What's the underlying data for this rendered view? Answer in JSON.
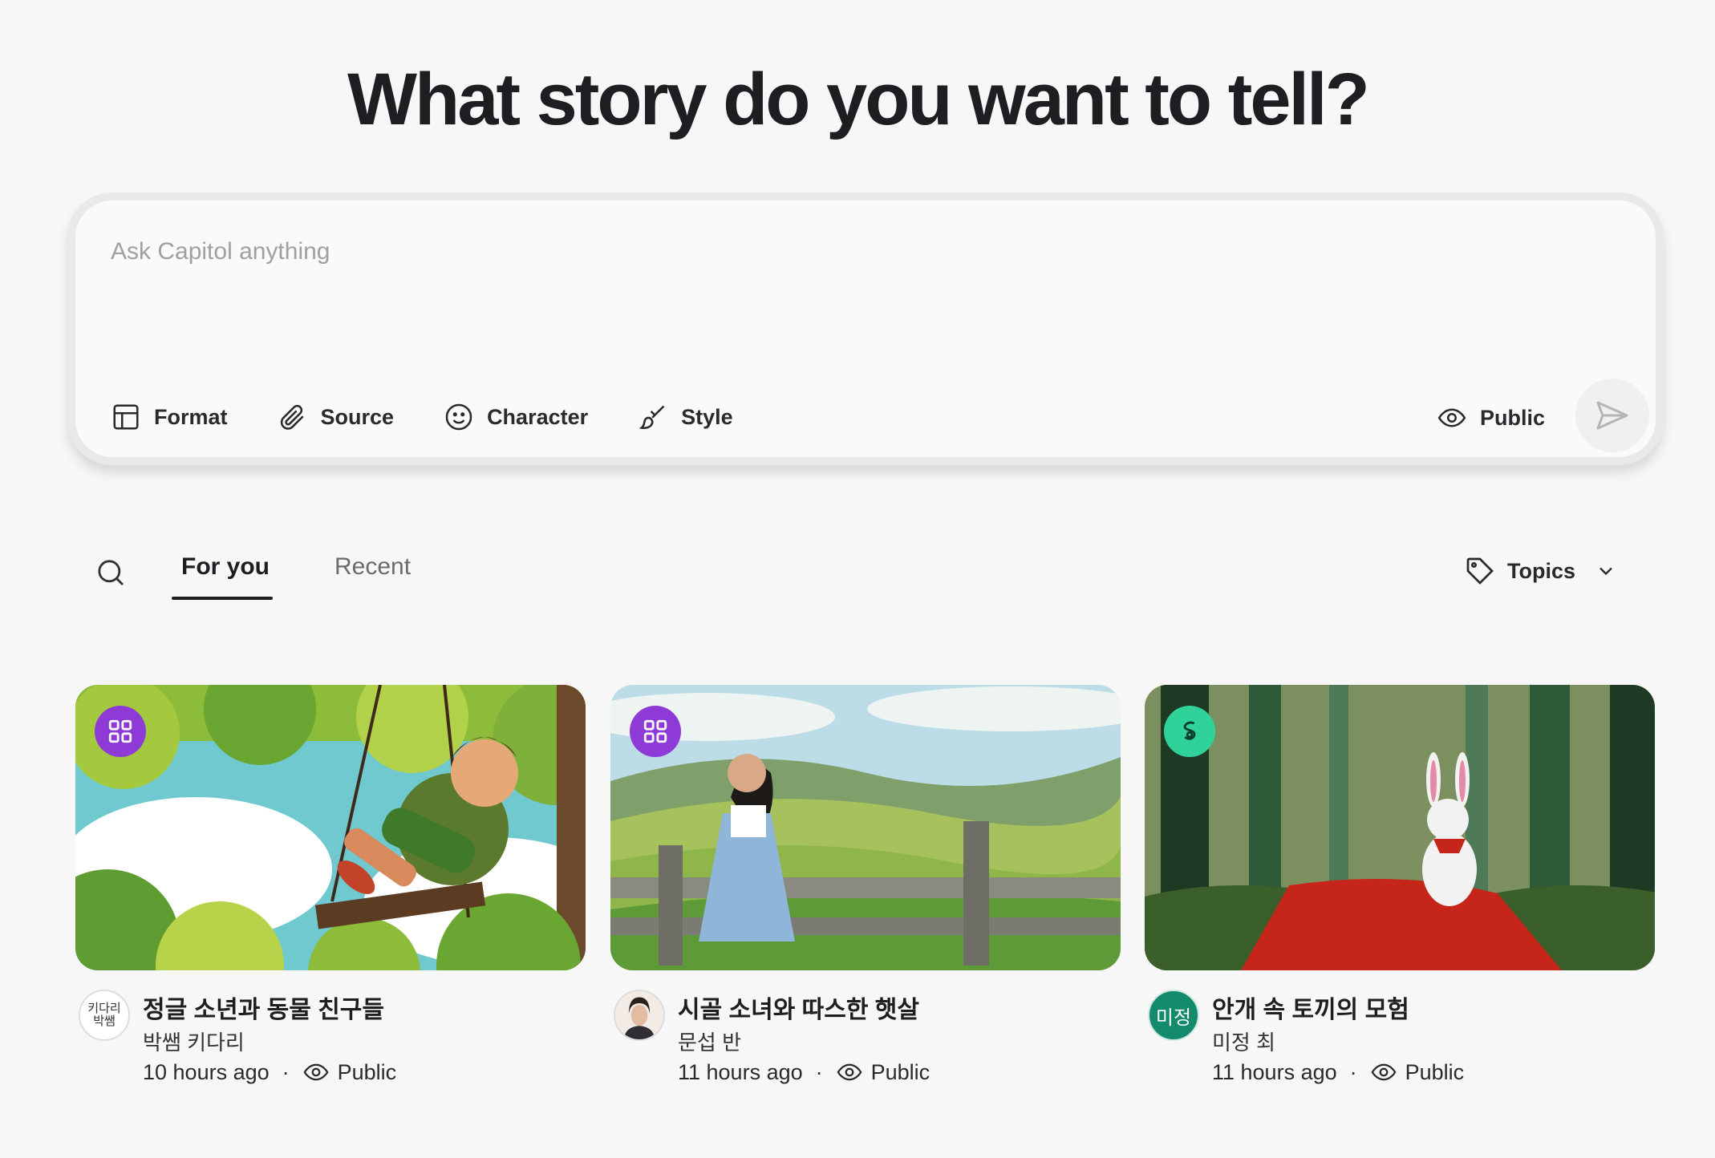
{
  "headline": "What story do you want to tell?",
  "prompt": {
    "placeholder": "Ask Capitol anything",
    "tools": [
      "Format",
      "Source",
      "Character",
      "Style"
    ],
    "visibility": "Public"
  },
  "feed": {
    "tabs": [
      "For you",
      "Recent"
    ],
    "active_tab": "For you",
    "topics_label": "Topics"
  },
  "cards": [
    {
      "title": "정글 소년과 동물 친구들",
      "author": "박쌤 키다리",
      "time": "10 hours ago",
      "visibility": "Public",
      "avatar_text": "키다리 박쌤",
      "badge_icon": "grid-icon",
      "badge_color": "#8e3ad6"
    },
    {
      "title": "시골 소녀와 따스한 햇살",
      "author": "문섭 반",
      "time": "11 hours ago",
      "visibility": "Public",
      "badge_icon": "grid-icon",
      "badge_color": "#8e3ad6"
    },
    {
      "title": "안개 속 토끼의 모험",
      "author": "미정 최",
      "time": "11 hours ago",
      "visibility": "Public",
      "avatar_text": "미정",
      "badge_icon": "swirl-icon",
      "badge_color": "#2fd39a"
    }
  ],
  "separator": "·"
}
